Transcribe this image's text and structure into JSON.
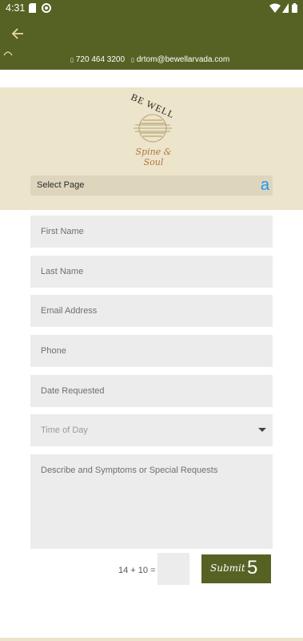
{
  "status_bar": {
    "time": "4:31"
  },
  "contact": {
    "phone": "720 464 3200",
    "email": "drtom@bewellarvada.com"
  },
  "logo": {
    "title": "BE WELL",
    "script": "Spine & Soul"
  },
  "nav": {
    "select_page": "Select Page",
    "badge": "a"
  },
  "form": {
    "first_name": "First Name",
    "last_name": "Last Name",
    "email": "Email Address",
    "phone": "Phone",
    "date": "Date Requested",
    "time_of_day": "Time of Day",
    "message": "Describe and Symptoms or Special Requests",
    "captcha": "14 + 10 =",
    "submit": "Submit",
    "submit_badge": "5"
  },
  "colors": {
    "brand_olive": "#556223",
    "header_beige": "#ece4cb",
    "field_gray": "#ececec",
    "badge_blue": "#2196f3"
  },
  "icons": [
    "sim-icon",
    "sync-icon",
    "wifi-icon",
    "battery-icon",
    "back-arrow-icon",
    "loading-spinner-icon",
    "phone-icon",
    "mail-icon",
    "dropdown-caret-icon"
  ]
}
